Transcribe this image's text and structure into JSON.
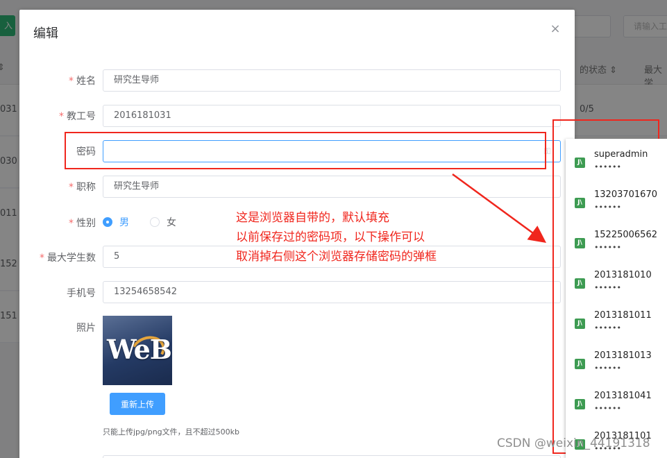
{
  "background": {
    "add_button_label": "入",
    "search_placeholder": "请输入工",
    "headers": [
      "的状态 ⇕",
      "最大学"
    ],
    "rows": [
      {
        "id": "031",
        "count": "0/5"
      },
      {
        "id": "030",
        "count": ""
      },
      {
        "id": "011",
        "count": ""
      },
      {
        "id": "152",
        "count": ""
      },
      {
        "id": "151",
        "count": ""
      }
    ],
    "sort_icon": "⇕"
  },
  "dialog": {
    "title": "编辑",
    "close_icon": "×",
    "fields": {
      "name": {
        "label": "姓名",
        "value": "研究生导师",
        "required": true
      },
      "staff_id": {
        "label": "教工号",
        "value": "2016181031",
        "required": true
      },
      "password": {
        "label": "密码",
        "value": "",
        "required": false
      },
      "title": {
        "label": "职称",
        "value": "研究生导师",
        "required": true
      },
      "gender": {
        "label": "性别",
        "options": [
          "男",
          "女"
        ],
        "selected": "男",
        "required": true
      },
      "max_students": {
        "label": "最大学生数",
        "value": "5",
        "required": true
      },
      "phone": {
        "label": "手机号",
        "value": "13254658542",
        "required": false
      },
      "photo": {
        "label": "照片",
        "image_text": "WeB"
      }
    },
    "required_mark": "*",
    "reupload_button": "重新上传",
    "upload_tip": "只能上传jpg/png文件，且不超过500kb"
  },
  "annotation": {
    "lines": [
      "这是浏览器自带的，默认填充",
      "以前保存过的密码项，以下操作可以",
      "取消掉右侧这个浏览器存储密码的弹框"
    ],
    "color": "#f0261d"
  },
  "password_dropdown": {
    "key_icon": "⚿",
    "icon_glyph": "J\\",
    "masked": "••••••",
    "entries": [
      "superadmin",
      "13203701670",
      "15225006562",
      "2013181010",
      "2013181011",
      "2013181013",
      "2013181041",
      "2013181101"
    ]
  },
  "watermark": "CSDN @weixin_44191318"
}
